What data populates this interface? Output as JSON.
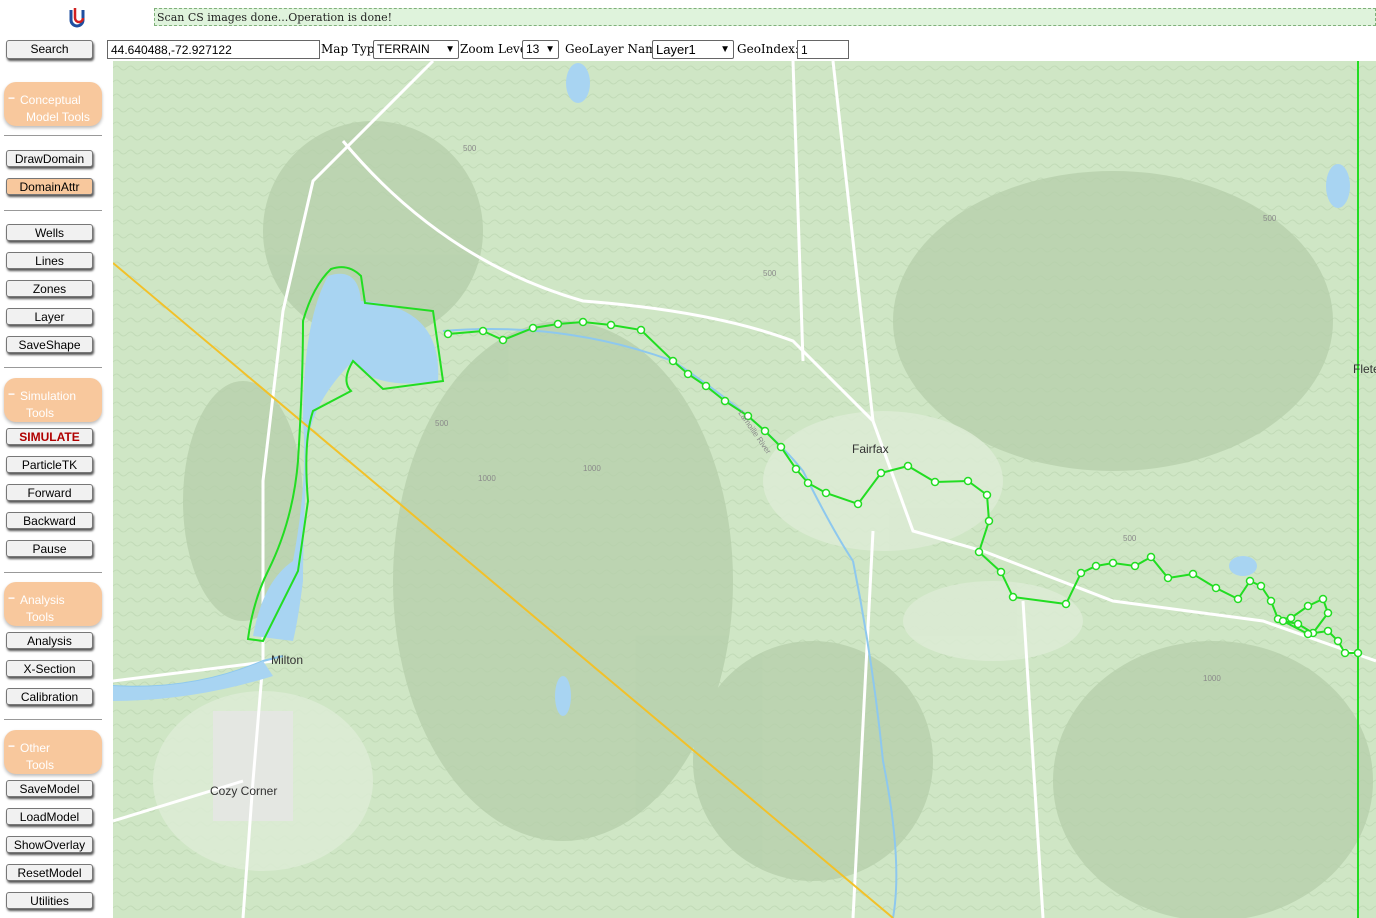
{
  "app": {
    "logo": "u-logo-icon",
    "status_message": "Scan CS images done...Operation is done!"
  },
  "toolbar": {
    "search_label": "Search",
    "coords_value": "44.640488,-72.927122",
    "map_type_label": "Map Type",
    "map_type_value": "TERRAIN",
    "zoom_label": "Zoom Level",
    "zoom_value": "13",
    "geolayer_label": "GeoLayer Name:",
    "geolayer_value": "Layer1",
    "geoindex_label": "GeoIndex:",
    "geoindex_value": "1"
  },
  "sidebar": {
    "conceptual": {
      "line1": "Conceptual",
      "line2": "Model Tools",
      "minus": "−"
    },
    "conceptual_buttons": [
      "DrawDomain",
      "DomainAttr"
    ],
    "shape_buttons": [
      "Wells",
      "Lines",
      "Zones",
      "Layer",
      "SaveShape"
    ],
    "simulation": {
      "line1": "Simulation",
      "line2": "Tools",
      "minus": "−"
    },
    "simulation_buttons": [
      "SIMULATE",
      "ParticleTK",
      "Forward",
      "Backward",
      "Pause"
    ],
    "analysis": {
      "line1": "Analysis",
      "line2": "Tools",
      "minus": "−"
    },
    "analysis_buttons": [
      "Analysis",
      "X-Section",
      "Calibration"
    ],
    "other": {
      "line1": "Other",
      "line2": "Tools",
      "minus": "−"
    },
    "other_buttons": [
      "SaveModel",
      "LoadModel",
      "ShowOverlay",
      "ResetModel",
      "Utilities"
    ]
  },
  "map": {
    "labels": {
      "fairfax": "Fairfax",
      "milton": "Milton",
      "cozy_corner": "Cozy Corner",
      "fletcher": "Flete",
      "river": "Lamoille River"
    },
    "contour_labels": [
      "500",
      "1000",
      "500",
      "1000",
      "500",
      "1000",
      "500",
      "500"
    ],
    "colors": {
      "terrain": "#cfe6c5",
      "water": "#a8d4f2",
      "polyline": "#22dd22",
      "road": "#f7c33a"
    }
  }
}
